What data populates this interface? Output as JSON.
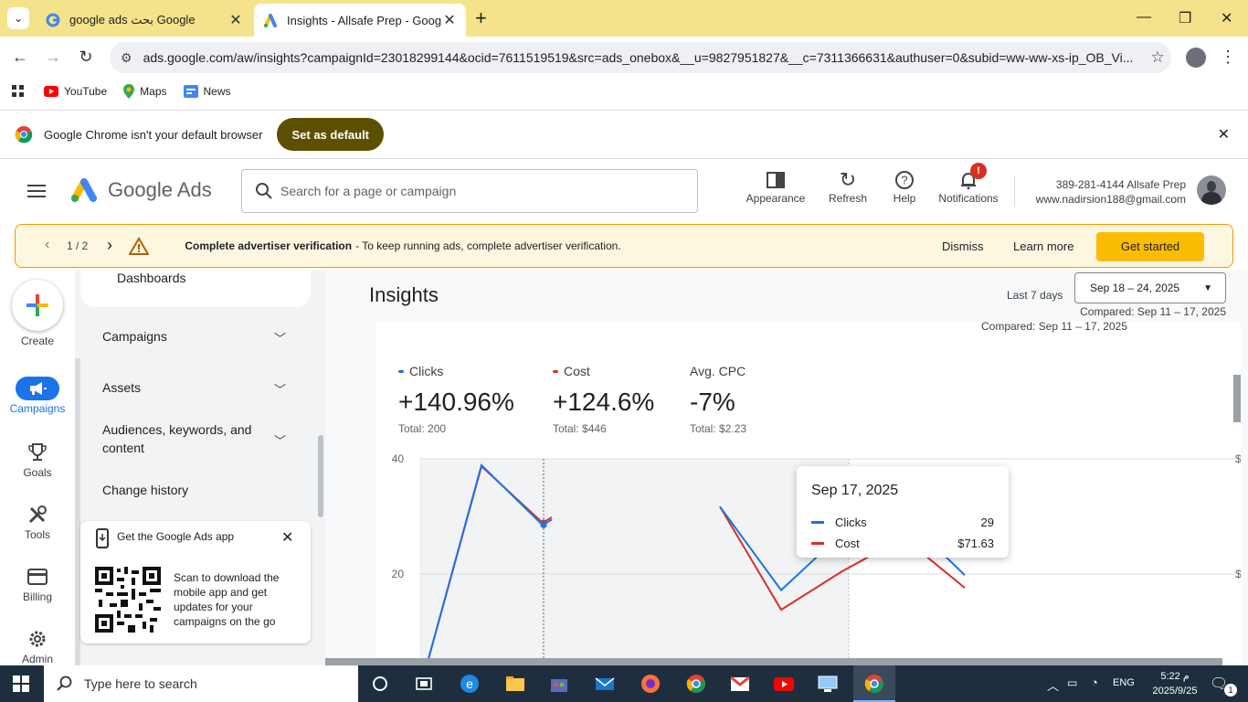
{
  "browser": {
    "tabs": [
      {
        "title": "google ads بحث Google",
        "icon": "google-icon",
        "active": false
      },
      {
        "title": "Insights - Allsafe Prep - Google",
        "icon": "google-ads-icon",
        "active": true
      }
    ],
    "url": "ads.google.com/aw/insights?campaignId=23018299144&ocid=7611519519&src=ads_onebox&__u=9827951827&__c=7311366631&authuser=0&subid=ww-ww-xs-ip_OB_Vi...",
    "bookmarks": [
      {
        "label": "YouTube",
        "icon": "youtube-icon"
      },
      {
        "label": "Maps",
        "icon": "maps-icon"
      },
      {
        "label": "News",
        "icon": "news-icon"
      }
    ],
    "infobar": {
      "message": "Google Chrome isn't your default browser",
      "button": "Set as default"
    }
  },
  "header": {
    "product": "Google Ads",
    "search_placeholder": "Search for a page or campaign",
    "buttons": {
      "appearance": "Appearance",
      "refresh": "Refresh",
      "help": "Help",
      "notifications": "Notifications"
    },
    "notification_badge": "!",
    "account": {
      "line1": "389-281-4144 Allsafe Prep",
      "line2": "www.nadirsion188@gmail.com"
    }
  },
  "banner": {
    "pager": "1 / 2",
    "title": "Complete advertiser verification",
    "description": "- To keep running ads, complete advertiser verification.",
    "dismiss": "Dismiss",
    "learn_more": "Learn more",
    "cta": "Get started"
  },
  "rail": {
    "create": "Create",
    "campaigns": "Campaigns",
    "goals": "Goals",
    "tools": "Tools",
    "billing": "Billing",
    "admin": "Admin"
  },
  "sidenav": {
    "dashboards": "Dashboards",
    "campaigns": "Campaigns",
    "assets": "Assets",
    "audiences_1": "Audiences, keywords, and",
    "audiences_2": "content",
    "change_history": "Change history",
    "app_card": {
      "title": "Get the Google Ads app",
      "description": "Scan to download the mobile app and get updates for your campaigns on the go"
    }
  },
  "main": {
    "title": "Insights",
    "range_label": "Last 7 days",
    "date_range": "Sep 18 – 24, 2025",
    "compared": "Compared: Sep 11 – 17, 2025",
    "compared_inner": "Compared: Sep 11 – 17, 2025",
    "metrics": [
      {
        "label": "Clicks",
        "value": "+140.96%",
        "total": "Total: 200",
        "color": "#1a73e8"
      },
      {
        "label": "Cost",
        "value": "+124.6%",
        "total": "Total: $446",
        "color": "#d93025"
      },
      {
        "label": "Avg. CPC",
        "value": "-7%",
        "total": "Total: $2.23",
        "color": ""
      }
    ],
    "tooltip": {
      "date": "Sep 17, 2025",
      "rows": [
        {
          "name": "Clicks",
          "value": "29",
          "color": "#1a73e8"
        },
        {
          "name": "Cost",
          "value": "$71.63",
          "color": "#d93025"
        }
      ]
    }
  },
  "chart_data": {
    "type": "line",
    "y_ticks": [
      "40",
      "20"
    ],
    "ylim": [
      0,
      40
    ],
    "right_ticks": [
      "$",
      "$"
    ],
    "series": [
      {
        "name": "Clicks",
        "color": "#1a73e8",
        "values": [
          null,
          38.9,
          28.5,
          null,
          31.7,
          17.2,
          27.1,
          30.1,
          19.8
        ]
      },
      {
        "name": "Cost",
        "color": "#d93025",
        "values": [
          null,
          38.7,
          28.9,
          null,
          31.7,
          13.8,
          20.5,
          26.3,
          17.6
        ]
      }
    ],
    "segments_visible": [
      [
        0.35,
        0
      ],
      [
        1,
        38.9
      ]
    ],
    "grid": true
  },
  "taskbar": {
    "search_placeholder": "Type here to search",
    "language": "ENG",
    "time": "5:22 م",
    "date": "2025/9/25",
    "notif_count": "1"
  }
}
